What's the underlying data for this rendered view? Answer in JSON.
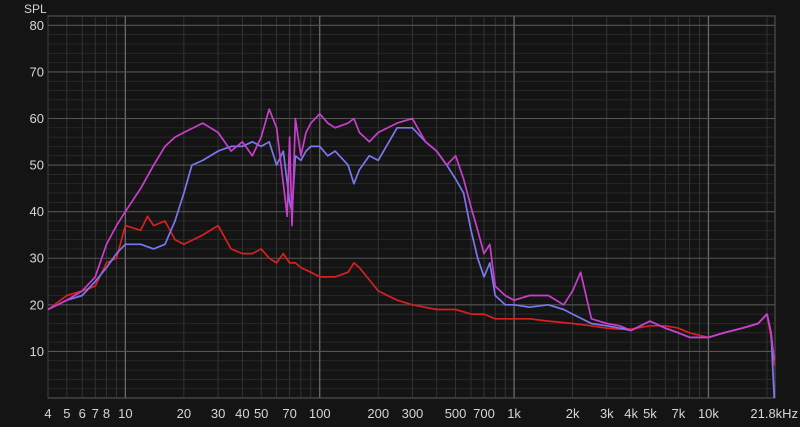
{
  "chart_data": {
    "type": "line",
    "title": "",
    "ylabel": "SPL",
    "xlabel": "",
    "x_scale": "log",
    "xlim": [
      4,
      22000
    ],
    "ylim": [
      0,
      82
    ],
    "grid": true,
    "x_ticks": [
      {
        "value": 4,
        "label": "4"
      },
      {
        "value": 5,
        "label": "5"
      },
      {
        "value": 6,
        "label": "6"
      },
      {
        "value": 7,
        "label": "7"
      },
      {
        "value": 8,
        "label": "8"
      },
      {
        "value": 10,
        "label": "10"
      },
      {
        "value": 20,
        "label": "20"
      },
      {
        "value": 30,
        "label": "30"
      },
      {
        "value": 40,
        "label": "40"
      },
      {
        "value": 50,
        "label": "50"
      },
      {
        "value": 70,
        "label": "70"
      },
      {
        "value": 100,
        "label": "100"
      },
      {
        "value": 200,
        "label": "200"
      },
      {
        "value": 300,
        "label": "300"
      },
      {
        "value": 500,
        "label": "500"
      },
      {
        "value": 700,
        "label": "700"
      },
      {
        "value": 1000,
        "label": "1k"
      },
      {
        "value": 2000,
        "label": "2k"
      },
      {
        "value": 3000,
        "label": "3k"
      },
      {
        "value": 4000,
        "label": "4k"
      },
      {
        "value": 5000,
        "label": "5k"
      },
      {
        "value": 7000,
        "label": "7k"
      },
      {
        "value": 10000,
        "label": "10k"
      },
      {
        "value": 21800,
        "label": "21.8kHz"
      }
    ],
    "y_ticks": [
      {
        "value": 10,
        "label": "10"
      },
      {
        "value": 20,
        "label": "20"
      },
      {
        "value": 30,
        "label": "30"
      },
      {
        "value": 40,
        "label": "40"
      },
      {
        "value": 50,
        "label": "50"
      },
      {
        "value": 60,
        "label": "60"
      },
      {
        "value": 70,
        "label": "70"
      },
      {
        "value": 80,
        "label": "80"
      }
    ],
    "series": [
      {
        "color": "#d92020",
        "x": [
          4,
          5,
          6,
          7,
          8,
          9,
          10,
          12,
          13,
          14,
          16,
          18,
          20,
          25,
          30,
          35,
          40,
          45,
          50,
          55,
          60,
          65,
          70,
          75,
          80,
          90,
          100,
          120,
          140,
          150,
          160,
          200,
          250,
          300,
          400,
          500,
          600,
          700,
          800,
          1000,
          1200,
          1500,
          2000,
          2500,
          3000,
          3500,
          4000,
          5000,
          6000,
          7000,
          8000,
          10000,
          12000,
          15000,
          18000,
          20000,
          21000,
          21800
        ],
        "y": [
          19,
          22,
          23,
          24,
          29,
          30,
          37,
          36,
          39,
          37,
          38,
          34,
          33,
          35,
          37,
          32,
          31,
          31,
          32,
          30,
          29,
          31,
          29,
          29,
          28,
          27,
          26,
          26,
          27,
          29,
          28,
          23,
          21,
          20,
          19,
          19,
          18,
          18,
          17,
          17,
          17,
          16.5,
          16,
          15.5,
          15,
          14.8,
          14.8,
          15.5,
          15.5,
          15,
          14,
          13,
          14,
          15,
          16,
          18,
          13,
          7
        ]
      },
      {
        "color": "#7a78f0",
        "x": [
          4,
          5,
          6,
          7,
          8,
          9,
          10,
          12,
          14,
          16,
          18,
          20,
          22,
          25,
          30,
          35,
          40,
          45,
          50,
          55,
          60,
          65,
          70,
          72,
          75,
          80,
          85,
          90,
          100,
          110,
          120,
          140,
          150,
          160,
          180,
          200,
          250,
          300,
          350,
          400,
          450,
          500,
          550,
          600,
          650,
          700,
          750,
          800,
          900,
          1000,
          1200,
          1500,
          1800,
          2000,
          2500,
          3000,
          3500,
          4000,
          5000,
          6000,
          7000,
          8000,
          10000,
          12000,
          15000,
          18000,
          20000,
          21000,
          21800
        ],
        "y": [
          19,
          21,
          22,
          25,
          28,
          31,
          33,
          33,
          32,
          33,
          38,
          44,
          50,
          51,
          53,
          54,
          54,
          55,
          54,
          55,
          50,
          53,
          42,
          40,
          52,
          51,
          53,
          54,
          54,
          52,
          53,
          50,
          46,
          49,
          52,
          51,
          58,
          58,
          55,
          53,
          50,
          47,
          44,
          36,
          30,
          26,
          29,
          22,
          20,
          20,
          19.5,
          20,
          19,
          18,
          16,
          15.5,
          15,
          14.5,
          16.5,
          15,
          14,
          13,
          13,
          14,
          15,
          16,
          18,
          14,
          0
        ]
      },
      {
        "color": "#c93fcc",
        "x": [
          4,
          5,
          6,
          7,
          8,
          9,
          10,
          12,
          14,
          16,
          18,
          20,
          25,
          30,
          35,
          40,
          45,
          50,
          55,
          60,
          65,
          68,
          70,
          72,
          75,
          80,
          85,
          90,
          100,
          110,
          120,
          140,
          150,
          160,
          180,
          200,
          250,
          300,
          350,
          400,
          450,
          500,
          550,
          600,
          650,
          700,
          750,
          800,
          900,
          1000,
          1200,
          1500,
          1800,
          2000,
          2200,
          2500,
          3000,
          3500,
          4000,
          5000,
          6000,
          7000,
          8000,
          10000,
          12000,
          15000,
          18000,
          20000,
          21000,
          21800
        ],
        "y": [
          19,
          21,
          23,
          26,
          33,
          37,
          40,
          45,
          50,
          54,
          56,
          57,
          59,
          57,
          53,
          55,
          52,
          56,
          62,
          58,
          46,
          39,
          56,
          37,
          60,
          52,
          57,
          59,
          61,
          59,
          58,
          59,
          60,
          57,
          55,
          57,
          59,
          60,
          55,
          53,
          50,
          52,
          47,
          41,
          36,
          31,
          33,
          24,
          22,
          21,
          22,
          22,
          20,
          23,
          27,
          17,
          16,
          15.5,
          14.5,
          16.5,
          15,
          14,
          13,
          13,
          14,
          15,
          16,
          18,
          14,
          8
        ]
      }
    ]
  }
}
